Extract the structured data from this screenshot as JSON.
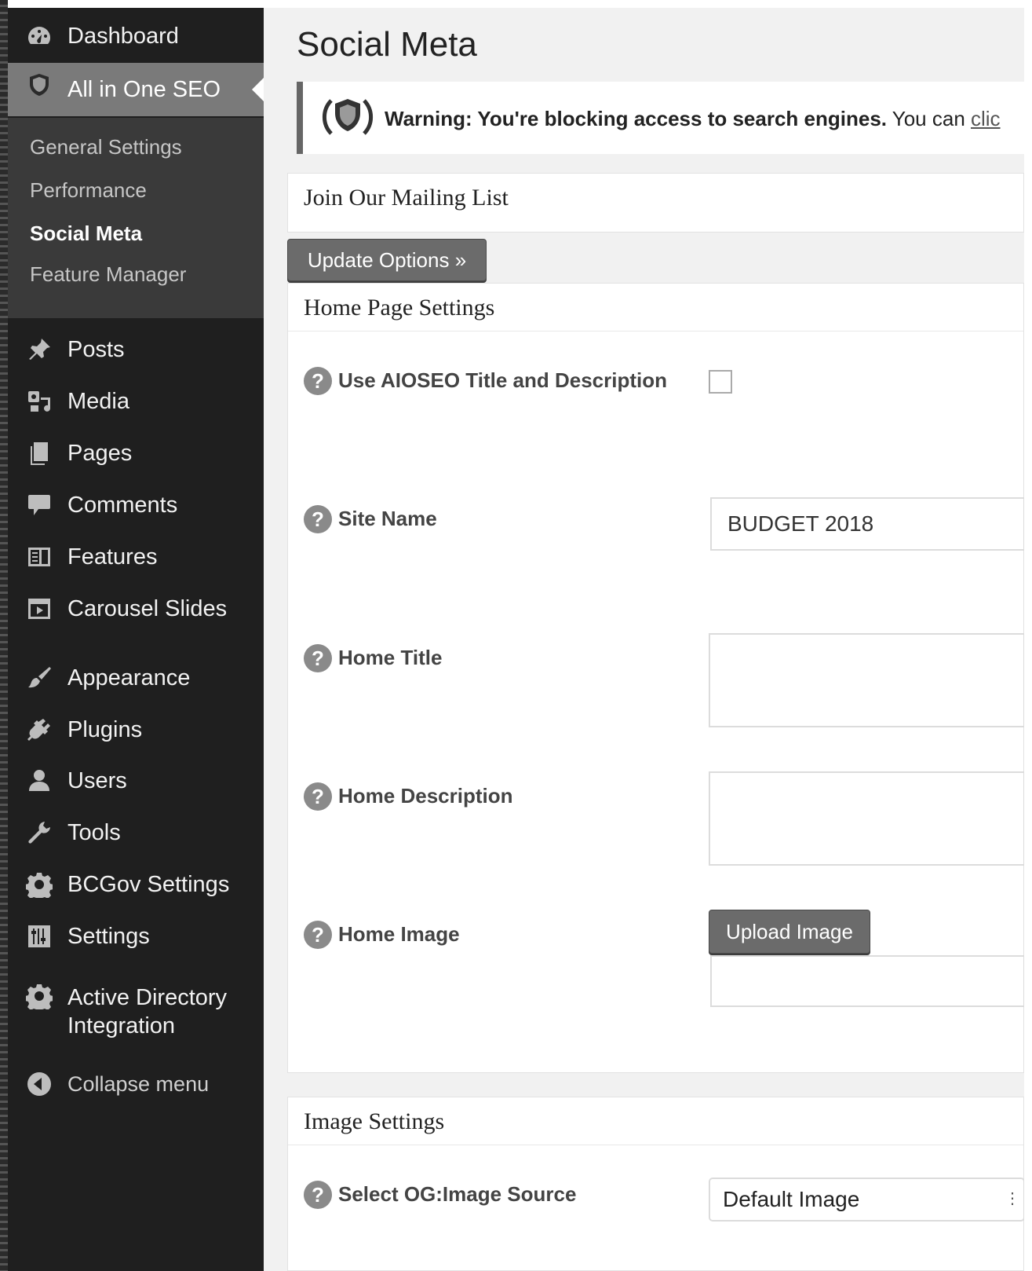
{
  "sidebar": {
    "dashboard": "Dashboard",
    "all_in_one_seo": "All in One SEO",
    "submenu": [
      "General Settings",
      "Performance",
      "Social Meta",
      "Feature Manager"
    ],
    "posts": "Posts",
    "media": "Media",
    "pages": "Pages",
    "comments": "Comments",
    "features": "Features",
    "carousel_slides": "Carousel Slides",
    "appearance": "Appearance",
    "plugins": "Plugins",
    "users": "Users",
    "tools": "Tools",
    "bcgov_settings": "BCGov Settings",
    "settings": "Settings",
    "active_directory_line1": "Active Directory",
    "active_directory_line2": "Integration",
    "collapse_menu": "Collapse menu"
  },
  "main": {
    "page_title": "Social Meta",
    "warning": {
      "bold": "Warning: You're blocking access to search engines.",
      "rest": " You can ",
      "link": "clic"
    },
    "mailing_list_title": "Join Our Mailing List",
    "update_button": "Update Options »",
    "home_page_settings_title": "Home Page Settings",
    "fields": {
      "use_aioseo": "Use AIOSEO Title and Description",
      "site_name": "Site Name",
      "site_name_value": "BUDGET 2018",
      "home_title": "Home Title",
      "home_description": "Home Description",
      "home_image": "Home Image",
      "upload_image": "Upload Image"
    },
    "image_settings_title": "Image Settings",
    "og_image_source_label": "Select OG:Image Source",
    "og_image_source_value": "Default Image"
  }
}
